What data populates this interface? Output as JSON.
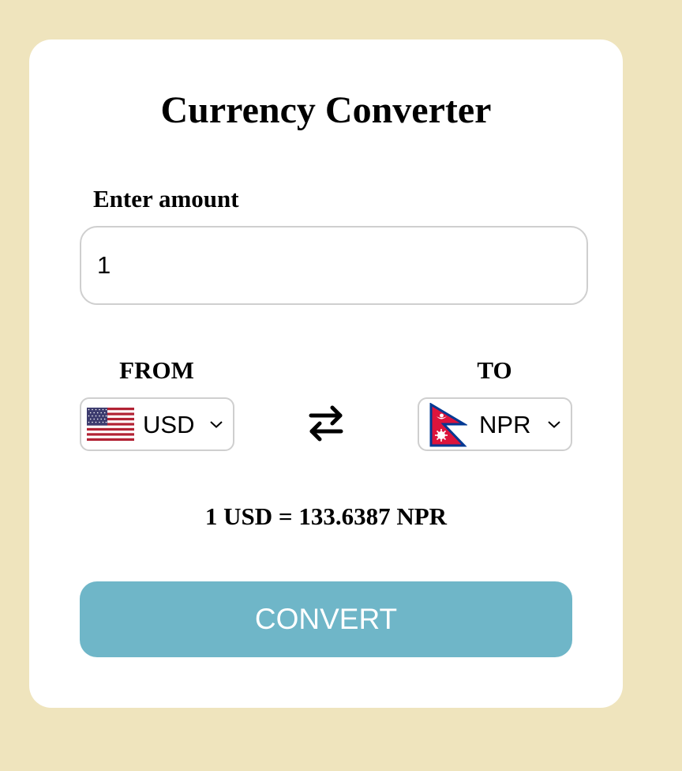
{
  "title": "Currency Converter",
  "amount": {
    "label": "Enter amount",
    "value": "1"
  },
  "from": {
    "label": "FROM",
    "code": "USD",
    "flag_icon": "us-flag-icon"
  },
  "to": {
    "label": "TO",
    "code": "NPR",
    "flag_icon": "nepal-flag-icon"
  },
  "swap_icon": "swap-arrows-icon",
  "rate_text": "1 USD = 133.6387 NPR",
  "convert_label": "CONVERT",
  "colors": {
    "background": "#efe4bd",
    "card": "#ffffff",
    "button": "#6fb6c8",
    "button_text": "#ffffff",
    "border": "#cfcfcf"
  }
}
